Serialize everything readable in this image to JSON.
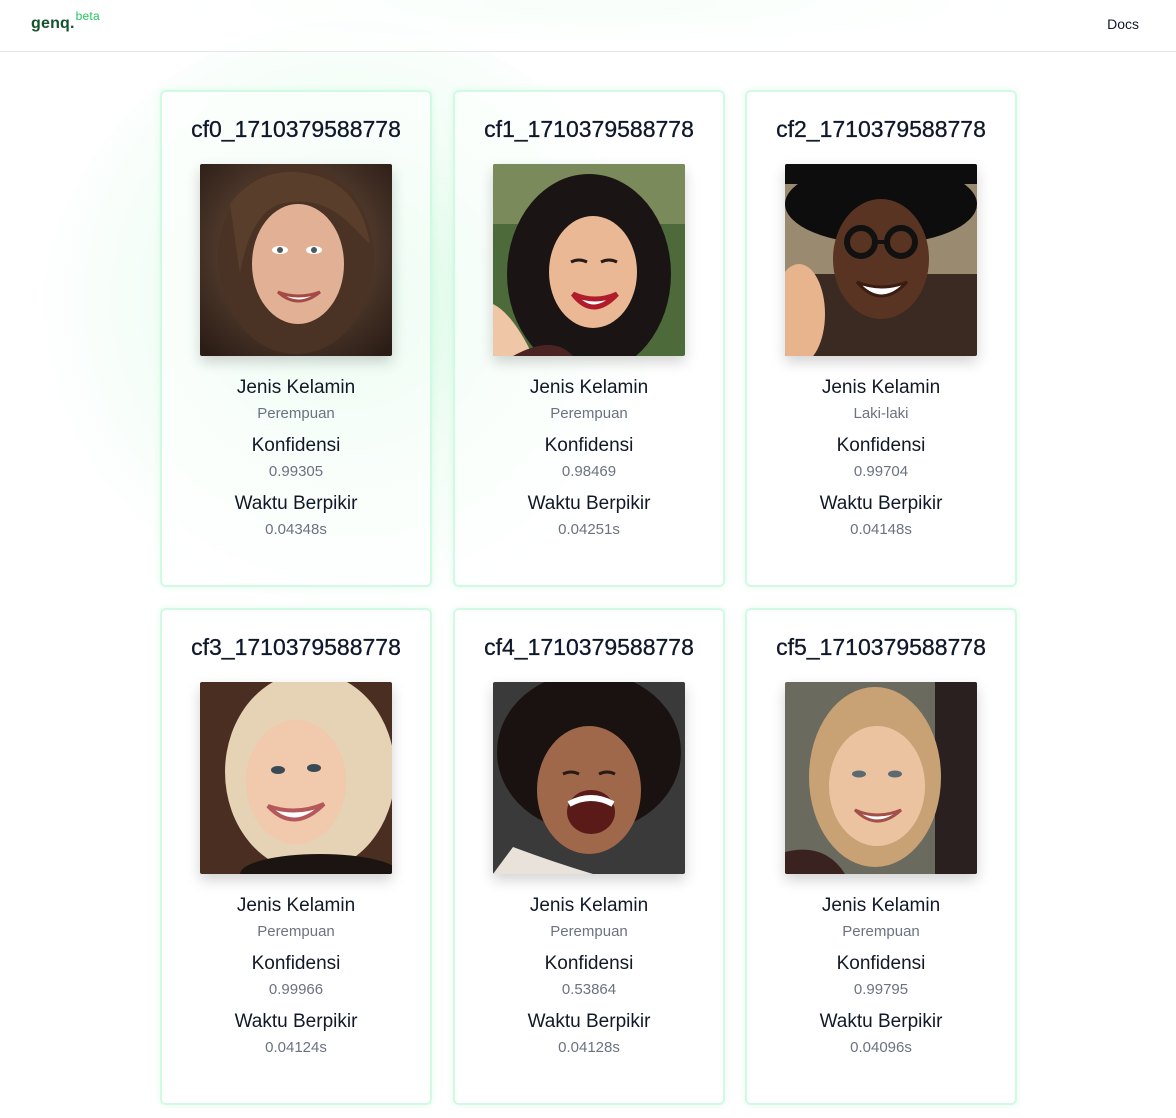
{
  "header": {
    "brand": "genq.",
    "brand_sup": "beta",
    "docs_label": "Docs"
  },
  "labels": {
    "gender": "Jenis Kelamin",
    "confidence": "Konfidensi",
    "time": "Waktu Berpikir"
  },
  "cards": [
    {
      "title": "cf0_1710379588778",
      "gender": "Perempuan",
      "confidence": "0.99305",
      "time": "0.04348s"
    },
    {
      "title": "cf1_1710379588778",
      "gender": "Perempuan",
      "confidence": "0.98469",
      "time": "0.04251s"
    },
    {
      "title": "cf2_1710379588778",
      "gender": "Laki-laki",
      "confidence": "0.99704",
      "time": "0.04148s"
    },
    {
      "title": "cf3_1710379588778",
      "gender": "Perempuan",
      "confidence": "0.99966",
      "time": "0.04124s"
    },
    {
      "title": "cf4_1710379588778",
      "gender": "Perempuan",
      "confidence": "0.53864",
      "time": "0.04128s"
    },
    {
      "title": "cf5_1710379588778",
      "gender": "Perempuan",
      "confidence": "0.99795",
      "time": "0.04096s"
    }
  ],
  "colors": {
    "brand": "#14532d",
    "beta": "#22c55e",
    "card_border": "#d1fae5"
  }
}
